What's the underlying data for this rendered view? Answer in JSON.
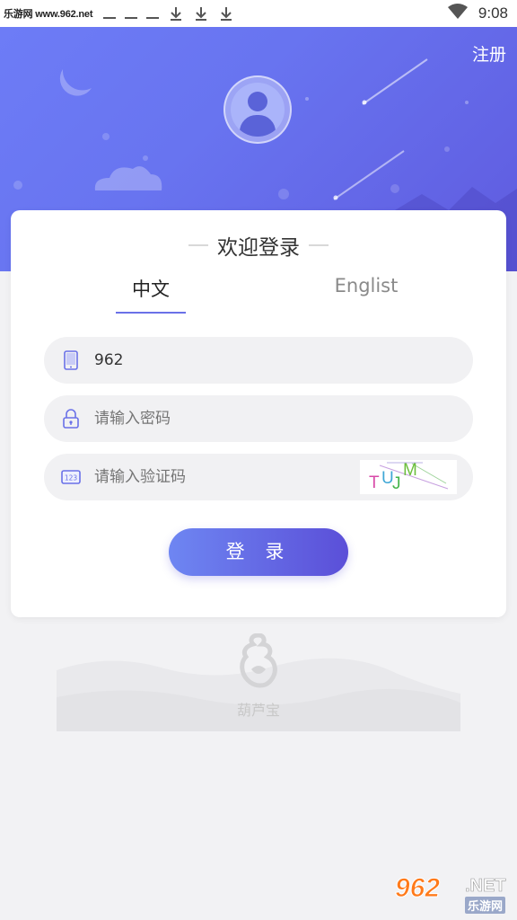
{
  "status_bar": {
    "site": "乐游网 www.962.net",
    "time": "9:08"
  },
  "header": {
    "register_label": "注册"
  },
  "card": {
    "title": "欢迎登录",
    "tabs": [
      {
        "label": "中文",
        "active": true
      },
      {
        "label": "Englist",
        "active": false
      }
    ]
  },
  "form": {
    "phone_value": "962",
    "password_placeholder": "请输入密码",
    "code_placeholder": "请输入验证码",
    "captcha_text": "TUJM"
  },
  "login_button": "登 录",
  "footer": {
    "brand": "葫芦宝"
  },
  "watermark": {
    "number": "962",
    "suffix": ".NET",
    "cn": "乐游网"
  },
  "colors": {
    "accent": "#6a71e8",
    "header_start": "#6d7cf6",
    "header_end": "#5f5bdf"
  }
}
